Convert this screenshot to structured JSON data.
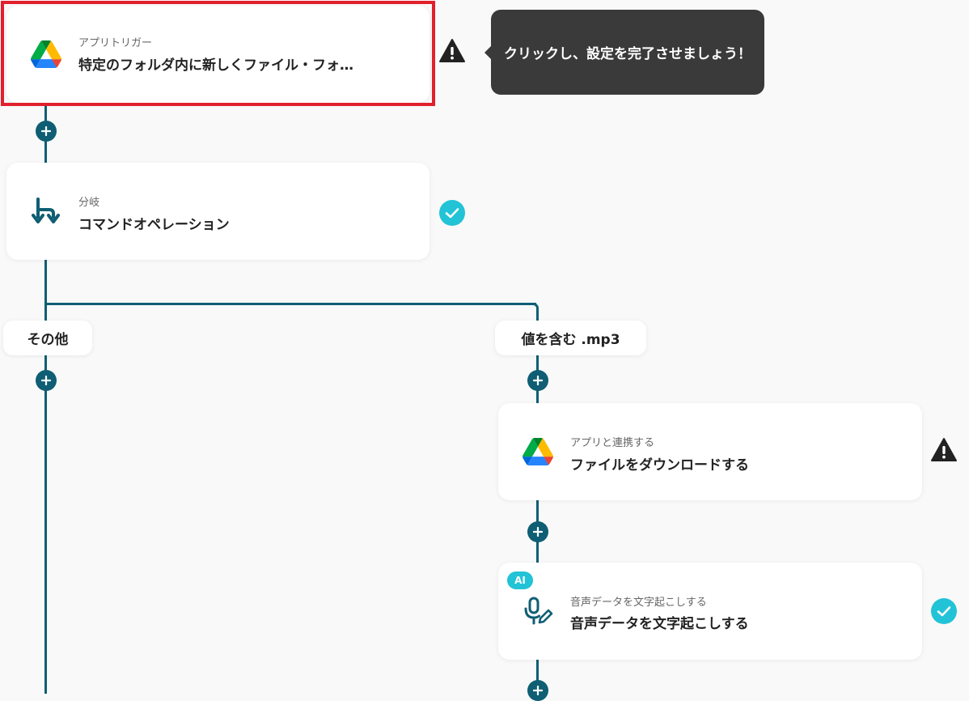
{
  "trigger": {
    "label": "アプリトリガー",
    "title": "特定のフォルダ内に新しくファイル・フォ…",
    "icon": "google-drive-icon"
  },
  "tooltip": {
    "text": "クリックし、設定を完了させましょう！"
  },
  "branch_step": {
    "label": "分岐",
    "title": "コマンドオペレーション",
    "icon": "branch-icon"
  },
  "branches": {
    "left": {
      "label": "その他"
    },
    "right": {
      "label": "値を含む .mp3"
    }
  },
  "download_step": {
    "label": "アプリと連携する",
    "title": "ファイルをダウンロードする",
    "icon": "google-drive-icon"
  },
  "transcribe_step": {
    "badge": "AI",
    "label": "音声データを文字起こしする",
    "title": "音声データを文字起こしする",
    "icon": "microphone-pen-icon"
  },
  "colors": {
    "connector": "#0f5e73",
    "check": "#22c3d6",
    "warning": "#222222",
    "highlight": "#e2202c",
    "tooltip_bg": "#3a3a3a"
  }
}
